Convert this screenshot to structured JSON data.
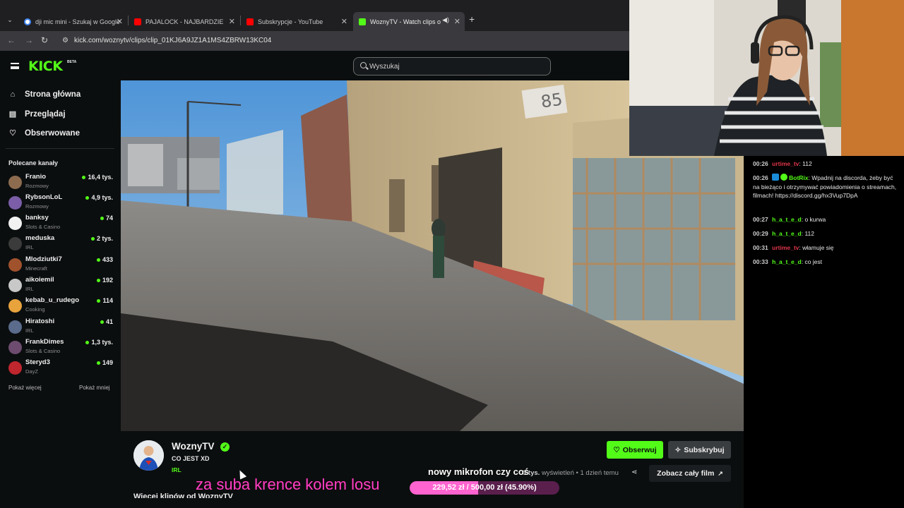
{
  "browser": {
    "tabs": [
      {
        "title": "dji mic mini - Szukaj w Google",
        "favicon_color": "#4285f4"
      },
      {
        "title": "PAJALOCK - NAJBARDZIEJ TOK",
        "favicon_color": "#ff0000"
      },
      {
        "title": "Subskrypcje - YouTube",
        "favicon_color": "#ff0000"
      },
      {
        "title": "WoznyTV - Watch clips on K",
        "favicon_color": "#53fc18"
      }
    ],
    "url": "kick.com/woznytv/clips/clip_01KJ6A9JZ1A1MS4ZBRW13KC04"
  },
  "header": {
    "logo": "KICK",
    "beta": "BETA",
    "search_placeholder": "Wyszukaj"
  },
  "sidebar": {
    "nav": [
      {
        "label": "Strona główna",
        "icon": "home-icon"
      },
      {
        "label": "Przeglądaj",
        "icon": "browse-icon"
      },
      {
        "label": "Obserwowane",
        "icon": "heart-icon"
      }
    ],
    "section_title": "Polecane kanały",
    "channels": [
      {
        "name": "Franio",
        "category": "Rozmowy",
        "viewers": "16,4 tys.",
        "color": "#8c6b4f"
      },
      {
        "name": "RybsonLoL",
        "category": "Rozmowy",
        "viewers": "4,9 tys.",
        "color": "#7b5ea7"
      },
      {
        "name": "banksy",
        "category": "Slots & Casino",
        "viewers": "74",
        "color": "#f2f2f2"
      },
      {
        "name": "meduska",
        "category": "IRL",
        "viewers": "2 tys.",
        "color": "#3b3b3b"
      },
      {
        "name": "Mlodziutki7",
        "category": "Minecraft",
        "viewers": "433",
        "color": "#a0522d"
      },
      {
        "name": "aikoiemil",
        "category": "IRL",
        "viewers": "192",
        "color": "#c8c8c8"
      },
      {
        "name": "kebab_u_rudego",
        "category": "Cooking",
        "viewers": "114",
        "color": "#e8a33d"
      },
      {
        "name": "Hiratoshi",
        "category": "IRL",
        "viewers": "41",
        "color": "#5a6b8c"
      },
      {
        "name": "FrankDimes",
        "category": "Slots & Casino",
        "viewers": "1,3 tys.",
        "color": "#6d4c6f"
      },
      {
        "name": "Steryd3",
        "category": "DayZ",
        "viewers": "149",
        "color": "#c0262d"
      }
    ],
    "show_more": "Pokaż więcej",
    "show_less": "Pokaż mniej"
  },
  "clip": {
    "channel_name": "WoznyTV",
    "title": "CO JEST XD",
    "tag": "IRL",
    "follow_label": "Obserwuj",
    "subscribe_label": "Subskrybuj",
    "views_count": "3 tys.",
    "views_label": "wyświetleń",
    "age": "1 dzień temu",
    "full_film_label": "Zobacz cały film",
    "more_clips": "Więcej klipów od WoznyTV"
  },
  "overlay": {
    "question": "nowy mikrofon czy coś",
    "pink_text": "za suba krence kolem losu",
    "goal_text": "229,52 zł / 500,00 zł (45.90%)",
    "goal_fraction": 0.459,
    "house_number": "85"
  },
  "chat": {
    "messages": [
      {
        "time": "00:26",
        "user": "urtime_tv",
        "user_color": "#e0364a",
        "text": "112",
        "badges": []
      },
      {
        "time": "00:26",
        "user": "BotRix",
        "user_color": "#53fc18",
        "text": "Wpadnij na discorda, żeby być na bieżąco i otrzymywać powiadomienia o streamach, filmach! https://discord.gg/hx3Vup7DpA",
        "badges": [
          "mod",
          "verified"
        ]
      },
      {
        "time": "00:27",
        "user": "h_a_t_e_d",
        "user_color": "#53fc18",
        "text": "o kurwa",
        "badges": []
      },
      {
        "time": "00:29",
        "user": "h_a_t_e_d",
        "user_color": "#53fc18",
        "text": "112",
        "badges": []
      },
      {
        "time": "00:31",
        "user": "urtime_tv",
        "user_color": "#e0364a",
        "text": "włamuje się",
        "badges": []
      },
      {
        "time": "00:33",
        "user": "h_a_t_e_d",
        "user_color": "#53fc18",
        "text": "co jest",
        "badges": []
      }
    ]
  }
}
